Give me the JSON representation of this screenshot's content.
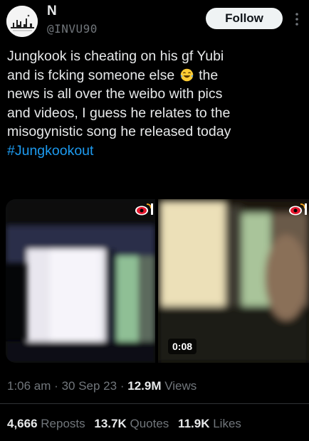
{
  "author": {
    "display_name": "N",
    "handle": "@INVU90",
    "avatar_icon": "city-skyline-avatar"
  },
  "actions": {
    "follow_label": "Follow",
    "more_icon": "more-vertical-icon"
  },
  "tweet": {
    "line1_a": "Jungkook is cheating on his gf Yubi",
    "line2_a": "and is fcking someone else",
    "emoji": "laughing-tears-emoji",
    "line2_b": "the",
    "line3": "news is all over the weibo with pics",
    "line4": "and videos, I guess he relates to the",
    "line5": "misogynistic song he released today",
    "hashtag": "#Jungkookout"
  },
  "media": {
    "video_duration": "0:08",
    "watermark_icon": "weibo-logo-icon"
  },
  "meta": {
    "time": "1:06 am",
    "sep1": "·",
    "date": "30 Sep 23",
    "sep2": "·",
    "views_count": "12.9M",
    "views_label": "Views"
  },
  "stats": {
    "reposts_count": "4,666",
    "reposts_label": "Reposts",
    "quotes_count": "13.7K",
    "quotes_label": "Quotes",
    "likes_count": "11.9K",
    "likes_label": "Likes"
  },
  "colors": {
    "background": "#000000",
    "text": "#e7e9ea",
    "muted": "#71767b",
    "link": "#1d9bf0",
    "follow_bg": "#eff3f4"
  }
}
